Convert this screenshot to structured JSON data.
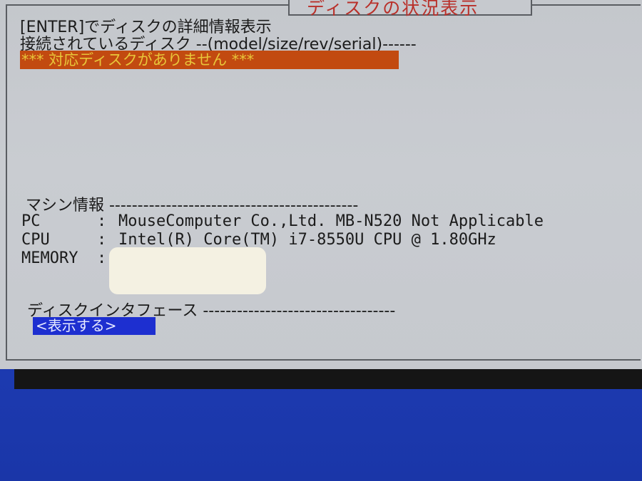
{
  "dialog": {
    "title": "ディスクの状況表示",
    "enter_hint": "[ENTER]でディスクの詳細情報表示",
    "disk_list_header": "接続されているディスク --(model/size/rev/serial)------",
    "no_disk_message": "*** 対応ディスクがありません ***"
  },
  "machine": {
    "header": "マシン情報 --------------------------------------------",
    "rows": [
      {
        "label": "PC",
        "value": "MouseComputer Co.,Ltd. MB-N520 Not Applicable"
      },
      {
        "label": "CPU",
        "value": "Intel(R) Core(TM) i7-8550U CPU @ 1.80GHz"
      },
      {
        "label": "MEMORY",
        "value": ""
      }
    ],
    "separator": ":"
  },
  "interface": {
    "header": "ディスクインタフェース ----------------------------------",
    "button_label": "<表示する>"
  },
  "colors": {
    "highlight_bg": "#c24a10",
    "highlight_text": "#e8c63a",
    "title_text": "#b9302a",
    "button_bg": "#1d2fd0",
    "screen_bg": "#1f3fb8"
  }
}
